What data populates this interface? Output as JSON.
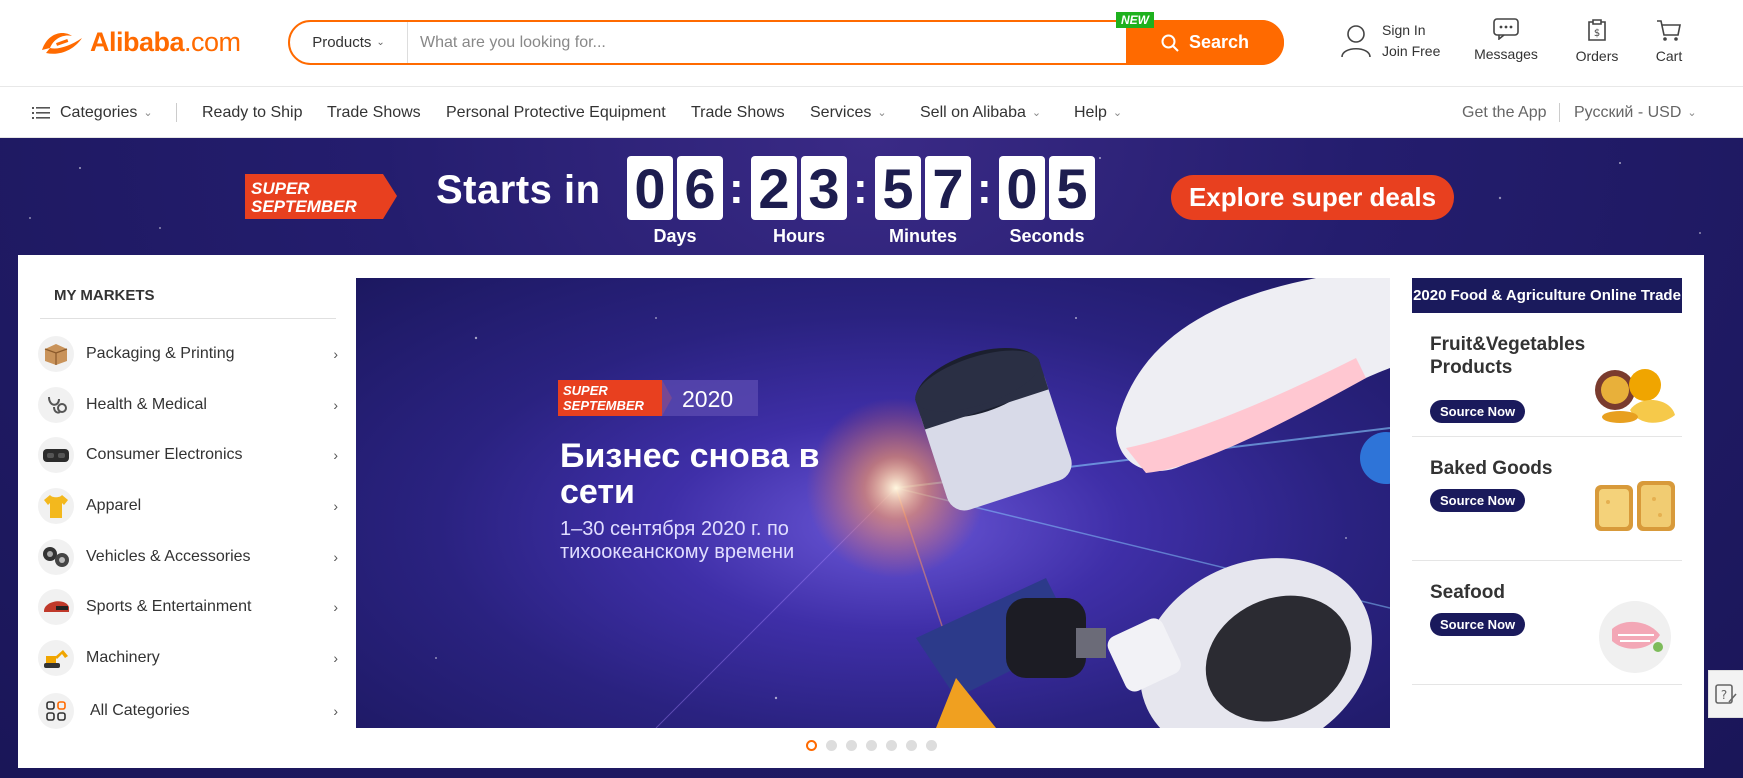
{
  "brand": {
    "logo_text": "Alibaba",
    "logo_suffix": ".com",
    "accent": "#ff6a00",
    "navy": "#1a1a5c"
  },
  "search": {
    "category": "Products",
    "placeholder": "What are you looking for...",
    "button_label": "Search",
    "new_badge": "NEW"
  },
  "user": {
    "sign_in": "Sign In",
    "join": "Join Free"
  },
  "header_icons": [
    {
      "icon": "messages-icon",
      "label": "Messages"
    },
    {
      "icon": "orders-icon",
      "label": "Orders"
    },
    {
      "icon": "cart-icon",
      "label": "Cart"
    }
  ],
  "nav": {
    "categories": "Categories",
    "items": [
      "Ready to Ship",
      "Trade Shows",
      "Personal Protective Equipment",
      "Trade Shows",
      "Services",
      "Sell on Alibaba",
      "Help"
    ],
    "get_app": "Get the App",
    "language": "Русский - USD"
  },
  "countdown": {
    "badge_line1": "SUPER",
    "badge_line2": "SEPTEMBER",
    "starts_in": "Starts in",
    "days": [
      "0",
      "6"
    ],
    "hours": [
      "2",
      "3"
    ],
    "minutes": [
      "5",
      "7"
    ],
    "seconds": [
      "0",
      "5"
    ],
    "units": [
      "Days",
      "Hours",
      "Minutes",
      "Seconds"
    ],
    "cta": "Explore super deals"
  },
  "markets": {
    "title": "MY MARKETS",
    "items": [
      {
        "label": "Packaging & Printing",
        "icon": "box-icon"
      },
      {
        "label": "Health & Medical",
        "icon": "stethoscope-icon"
      },
      {
        "label": "Consumer Electronics",
        "icon": "vr-headset-icon"
      },
      {
        "label": "Apparel",
        "icon": "tshirt-icon"
      },
      {
        "label": "Vehicles & Accessories",
        "icon": "wheels-icon"
      },
      {
        "label": "Sports & Entertainment",
        "icon": "helmet-icon"
      },
      {
        "label": "Machinery",
        "icon": "excavator-icon"
      },
      {
        "label": "All Categories",
        "icon": "grid-icon"
      }
    ]
  },
  "hero": {
    "badge_line1": "SUPER",
    "badge_line2": "SEPTEMBER",
    "badge_year": "2020",
    "title": "Бизнес снова в сети",
    "subtitle": "1–30 сентября 2020 г. по тихоокеанскому времени",
    "slides": 7,
    "active_slide": 1
  },
  "food": {
    "header": "2020 Food & Agriculture Online Trade",
    "cards": [
      {
        "name": "Fruit&Vegetables Products",
        "button": "Source Now",
        "image": "fruit-image"
      },
      {
        "name": "Baked Goods",
        "button": "Source Now",
        "image": "bread-image"
      },
      {
        "name": "Seafood",
        "button": "Source Now",
        "image": "seafood-image"
      }
    ]
  }
}
